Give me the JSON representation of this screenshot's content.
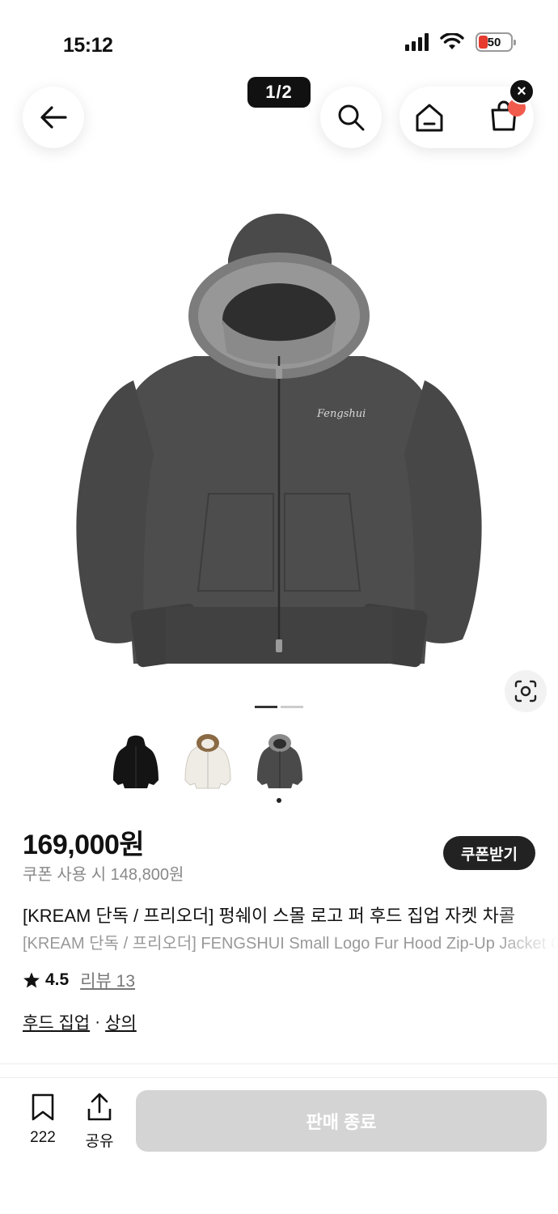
{
  "status_bar": {
    "time": "15:12",
    "battery": "50"
  },
  "nav": {
    "page_indicator": "1/2",
    "close_badge": "×"
  },
  "product": {
    "price": "169,000원",
    "coupon_price": "쿠폰 사용 시 148,800원",
    "coupon_button": "쿠폰받기",
    "title_kr": "[KREAM 단독 / 프리오더] 펑쉐이 스몰 로고 퍼 후드 집업 자켓 차콜",
    "title_en": "[KREAM 단독 / 프리오더] FENGSHUI Small Logo Fur Hood Zip-Up Jacket Charcoal",
    "rating": "4.5",
    "review_label": "리뷰 13",
    "categories": [
      "후드 집업",
      "상의"
    ],
    "category_separator": "·",
    "chest_logo_text": "Fengshui",
    "image_position": 1,
    "image_count": 2,
    "thumbnail_colors": [
      "#141414",
      "#efece6",
      "#4a4a4a"
    ],
    "selected_thumbnail": 3
  },
  "bottom_bar": {
    "bookmark_count": "222",
    "share_label": "공유",
    "buy_button": "판매 종료"
  },
  "colors": {
    "jacket": "#4a4a4a",
    "fur": "#8a8a8a",
    "badge_red": "#f15b4e",
    "disabled_button": "#d4d4d4"
  }
}
